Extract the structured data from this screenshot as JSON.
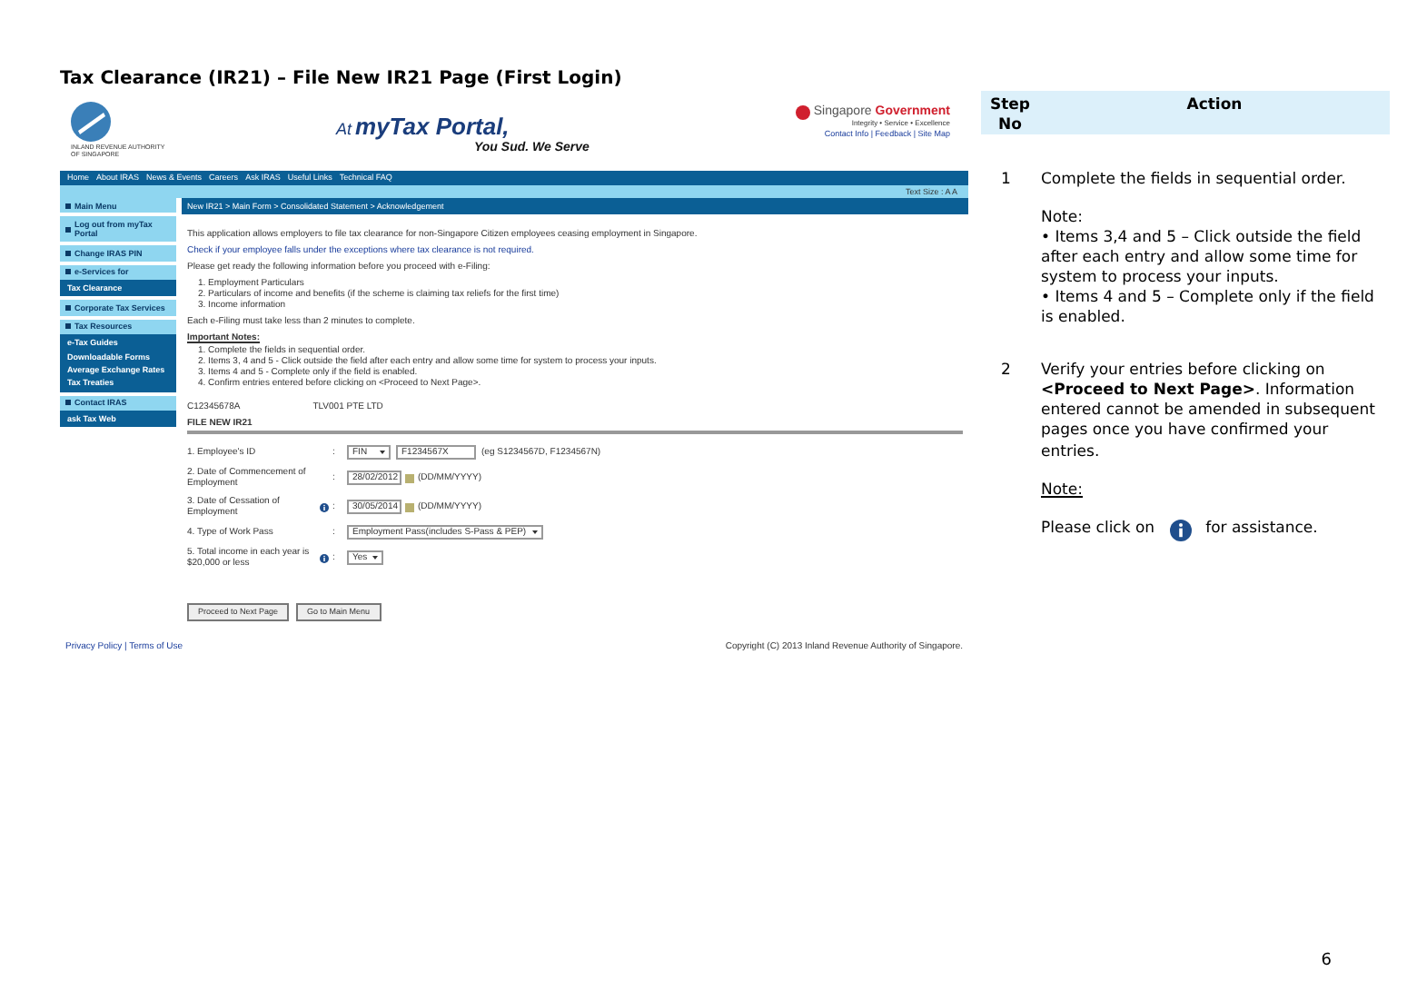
{
  "doc_title": "Tax Clearance (IR21) – File New IR21 Page (First Login)",
  "screenshot": {
    "header": {
      "agency": "INLAND REVENUE AUTHORITY OF SINGAPORE",
      "tagline_prefix": "At",
      "portal": "myTax Portal,",
      "tagline": "You Sud. We Serve",
      "gov_name": "Singapore",
      "gov_name_accent": "Government",
      "gov_motto": "Integrity • Service • Excellence",
      "gov_links": "Contact Info | Feedback | Site Map"
    },
    "nav_links": [
      "Home",
      "About IRAS",
      "News & Events",
      "Careers",
      "Ask IRAS",
      "Useful Links",
      "Technical FAQ"
    ],
    "text_size": "Text Size : A A",
    "sidebar": [
      {
        "label": "Main Menu"
      },
      {
        "label": "Log out from myTax Portal"
      },
      {
        "label": "Change IRAS PIN"
      },
      {
        "label": "e-Services for",
        "children": [
          "Tax Clearance"
        ]
      },
      {
        "label": "Corporate Tax Services"
      },
      {
        "label": "Tax Resources",
        "children": [
          "e-Tax Guides",
          "Downloadable Forms",
          "Average Exchange Rates",
          "Tax Treaties"
        ]
      },
      {
        "label": "Contact IRAS",
        "children": [
          "ask Tax Web"
        ]
      }
    ],
    "breadcrumb": "New IR21 > Main Form > Consolidated Statement > Acknowledgement",
    "intro": [
      {
        "kind": "text",
        "text": "This application allows employers to file tax clearance for non-Singapore Citizen employees ceasing employment in Singapore."
      },
      {
        "kind": "link",
        "text": "Check if your employee falls under the exceptions where tax clearance is not required."
      },
      {
        "kind": "text",
        "text": "Please get ready the following information before you proceed with e-Filing:"
      },
      {
        "kind": "list",
        "items": [
          "1. Employment Particulars",
          "2. Particulars of income and benefits (if the scheme is claiming tax reliefs for the first time)",
          "3. Income information"
        ]
      },
      {
        "kind": "text",
        "text": "Each e-Filing must take less than 2 minutes to complete."
      }
    ],
    "notes_title": "Important Notes:",
    "notes": [
      "1. Complete the fields in sequential order.",
      "2. Items 3, 4 and 5 - Click outside the field after each entry and allow some time for system to process your inputs.",
      "3. Items 4 and 5 - Complete only if the field is enabled.",
      "4. Confirm entries entered before clicking on <Proceed to Next Page>."
    ],
    "employer_ref": "C12345678A",
    "employer_name": "TLV001 PTE LTD",
    "section_title": "FILE NEW IR21",
    "fields": [
      {
        "kind": "id",
        "label": "1. Employee's ID",
        "info": false,
        "separator": ":",
        "id_type": "FIN",
        "value": "F1234567X",
        "hint": "(eg S1234567D, F1234567N)"
      },
      {
        "kind": "date",
        "label": "2. Date of Commencement of Employment",
        "info": false,
        "separator": ":",
        "value": "28/02/2012",
        "hint": "(DD/MM/YYYY)"
      },
      {
        "kind": "date",
        "label": "3. Date of Cessation of Employment",
        "info": true,
        "separator": ":",
        "value": "30/05/2014",
        "hint": "(DD/MM/YYYY)"
      },
      {
        "kind": "select",
        "label": "4. Type of Work Pass",
        "info": false,
        "separator": ":",
        "value": "Employment Pass(includes S-Pass & PEP)"
      },
      {
        "kind": "select",
        "label": "5. Total income in each year is $20,000 or less",
        "info": true,
        "separator": ":",
        "value": "Yes"
      }
    ],
    "buttons": [
      "Proceed to Next Page",
      "Go to Main Menu"
    ],
    "footer_links": "Privacy Policy | Terms of Use",
    "copyright": "Copyright (C) 2013 Inland Revenue Authority of Singapore."
  },
  "table": {
    "columns": [
      "Step No",
      "Action"
    ],
    "rows": [
      {
        "step": "1",
        "blocks": [
          {
            "kind": "text",
            "text": "Complete the fields in sequential order."
          },
          {
            "kind": "note",
            "title": "Note:",
            "lines": [
              "• Items 3,4 and 5 – Click outside the field after each entry and allow some time for system to process your inputs.",
              "• Items 4 and 5 – Complete only if the field is enabled."
            ]
          }
        ]
      },
      {
        "step": "2",
        "blocks": [
          {
            "kind": "text",
            "text": "Verify your entries before clicking on **<Proceed to Next Page>**. Information entered cannot be amended in subsequent pages once you have confirmed your entries."
          },
          {
            "kind": "note_underlined",
            "title": "Note:"
          },
          {
            "kind": "icon_text",
            "before": "Please click on",
            "after": "for assistance."
          }
        ]
      }
    ]
  },
  "page_number": "6"
}
